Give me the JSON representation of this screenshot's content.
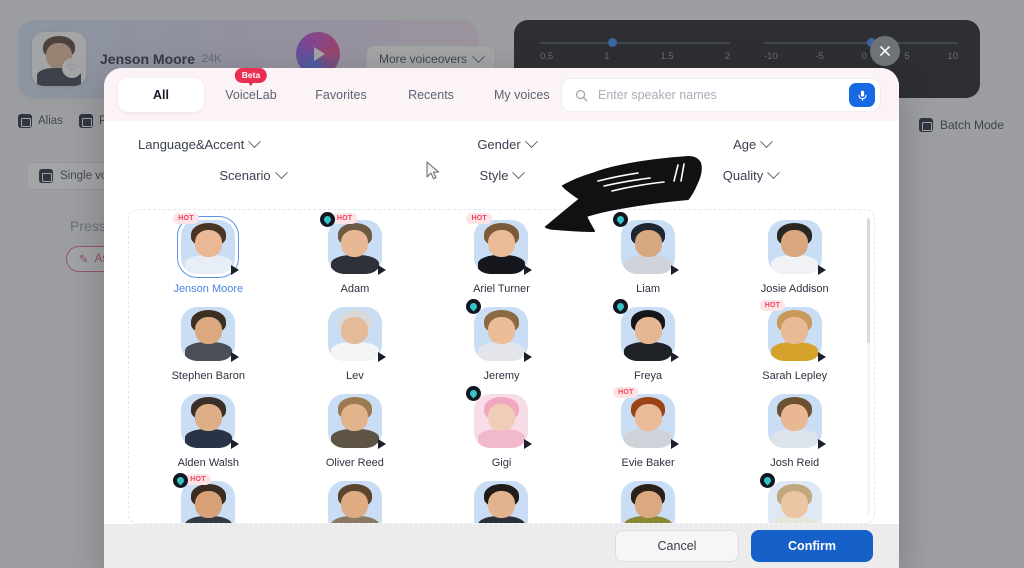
{
  "background": {
    "speaker_card": {
      "name": "Jenson Moore",
      "count": "24K",
      "heart_icon": "heart-icon",
      "play_icon": "play-icon"
    },
    "more_voiceovers": {
      "label": "More voiceovers",
      "chevron_icon": "chevron-down-icon"
    },
    "toolbar": [
      {
        "label": "Alias",
        "icon": "alias-icon"
      },
      {
        "label": "P",
        "icon": "pause-icon"
      }
    ],
    "batch_mode": {
      "label": "Batch Mode",
      "icon": "batch-icon"
    },
    "single_voice_chip": {
      "label": "Single voic",
      "icon": "list-icon"
    },
    "press_hint": "Press '/",
    "ask_button": {
      "label": "As",
      "icon": "magic-wand-icon"
    },
    "audio_panel": {
      "speed_slider": {
        "ticks": [
          "0.5",
          "1",
          "1.5",
          "2"
        ],
        "value_pct": 36
      },
      "pitch_slider": {
        "ticks": [
          "-10",
          "-5",
          "0",
          "5",
          "10"
        ],
        "value_pct": 53
      }
    },
    "close_button": {
      "icon": "close-icon"
    }
  },
  "modal": {
    "tabs": [
      {
        "label": "All",
        "active": true,
        "badge": null
      },
      {
        "label": "VoiceLab",
        "active": false,
        "badge": "Beta"
      },
      {
        "label": "Favorites",
        "active": false,
        "badge": null
      },
      {
        "label": "Recents",
        "active": false,
        "badge": null
      },
      {
        "label": "My voices",
        "active": false,
        "badge": null
      }
    ],
    "search": {
      "placeholder": "Enter speaker names",
      "value": "",
      "icon": "search-icon",
      "voice_icon": "microphone-icon"
    },
    "filters": [
      {
        "label": "Language&Accent"
      },
      {
        "label": "Gender"
      },
      {
        "label": "Age"
      },
      {
        "label": "Scenario"
      },
      {
        "label": "Style"
      },
      {
        "label": "Quality"
      }
    ],
    "voices": [
      {
        "name": "Jenson Moore",
        "hot": true,
        "cloned": false,
        "selected": true,
        "hair": "#4a3423",
        "skin": "#eab894",
        "body": "#e8eef6",
        "bg": "#c9def5"
      },
      {
        "name": "Adam",
        "hot": true,
        "cloned": true,
        "selected": false,
        "hair": "#6e5a44",
        "skin": "#e7b796",
        "body": "#2f3138",
        "bg": "#c9def5"
      },
      {
        "name": "Ariel Turner",
        "hot": true,
        "cloned": false,
        "selected": false,
        "hair": "#7a5a38",
        "skin": "#e9bb99",
        "body": "#15171c",
        "bg": "#c9def5"
      },
      {
        "name": "Liam",
        "hot": false,
        "cloned": true,
        "selected": false,
        "hair": "#20262f",
        "skin": "#d7a77f",
        "body": "#cfd4da",
        "bg": "#c9def5"
      },
      {
        "name": "Josie Addison",
        "hot": false,
        "cloned": false,
        "selected": false,
        "hair": "#2a2622",
        "skin": "#d9a87f",
        "body": "#f0f2f5",
        "bg": "#c9def5"
      },
      {
        "name": "Stephen Baron",
        "hot": false,
        "cloned": false,
        "selected": false,
        "hair": "#3c2f24",
        "skin": "#dda87f",
        "body": "#4a4f57",
        "bg": "#c9def5"
      },
      {
        "name": "Lev",
        "hot": false,
        "cloned": false,
        "selected": false,
        "hair": "#d9d9da",
        "skin": "#e3bb9b",
        "body": "#f4f5f7",
        "bg": "#c9def5"
      },
      {
        "name": "Jeremy",
        "hot": false,
        "cloned": true,
        "selected": false,
        "hair": "#8a6a43",
        "skin": "#ebbd97",
        "body": "#e3e5ea",
        "bg": "#c9def5"
      },
      {
        "name": "Freya",
        "hot": false,
        "cloned": true,
        "selected": false,
        "hair": "#141618",
        "skin": "#e6b794",
        "body": "#1e2126",
        "bg": "#c9def5"
      },
      {
        "name": "Sarah Lepley",
        "hot": true,
        "cloned": false,
        "selected": false,
        "hair": "#c79a5c",
        "skin": "#e8bb94",
        "body": "#d5a22c",
        "bg": "#c9def5"
      },
      {
        "name": "Alden Walsh",
        "hot": false,
        "cloned": false,
        "selected": false,
        "hair": "#3a3028",
        "skin": "#e0ae86",
        "body": "#2a3346",
        "bg": "#c9def5"
      },
      {
        "name": "Oliver Reed",
        "hot": false,
        "cloned": false,
        "selected": false,
        "hair": "#9a7a4e",
        "skin": "#e3b48c",
        "body": "#5e5443",
        "bg": "#c9def5"
      },
      {
        "name": "Gigi",
        "hot": false,
        "cloned": true,
        "selected": false,
        "hair": "#efa8bf",
        "skin": "#f0cdb6",
        "body": "#f2b9cc",
        "bg": "#f6dde6"
      },
      {
        "name": "Evie Baker",
        "hot": true,
        "cloned": false,
        "selected": false,
        "hair": "#9b4316",
        "skin": "#eabb99",
        "body": "#cfd3d9",
        "bg": "#c9def5"
      },
      {
        "name": "Josh Reid",
        "hot": false,
        "cloned": false,
        "selected": false,
        "hair": "#6d5232",
        "skin": "#e9b893",
        "body": "#dde3ea",
        "bg": "#c9def5"
      },
      {
        "name": "",
        "hot": true,
        "cloned": true,
        "selected": false,
        "hair": "#3a2c20",
        "skin": "#d8a077",
        "body": "#353b45",
        "bg": "#c9def5"
      },
      {
        "name": "",
        "hot": false,
        "cloned": false,
        "selected": false,
        "hair": "#5c452c",
        "skin": "#e0ac83",
        "body": "#8b7a63",
        "bg": "#c9def5"
      },
      {
        "name": "",
        "hot": false,
        "cloned": false,
        "selected": false,
        "hair": "#211c18",
        "skin": "#e3b38d",
        "body": "#2b3039",
        "bg": "#c9def5"
      },
      {
        "name": "",
        "hot": false,
        "cloned": false,
        "selected": false,
        "hair": "#2c2119",
        "skin": "#dba97f",
        "body": "#8b8634",
        "bg": "#c9def5"
      },
      {
        "name": "",
        "hot": false,
        "cloned": true,
        "selected": false,
        "hair": "#c0a77e",
        "skin": "#ecc6a4",
        "body": "#e8e6d8",
        "bg": "#dfe9f5"
      }
    ],
    "footer": {
      "cancel_label": "Cancel",
      "confirm_label": "Confirm"
    }
  },
  "annotation": {
    "type": "hand-drawn-arrow",
    "direction": "left"
  },
  "colors": {
    "accent_blue": "#1561c9",
    "hot_pink": "#f0425c",
    "beta_red": "#ea2f52",
    "selected_blue": "#4a86e0"
  }
}
